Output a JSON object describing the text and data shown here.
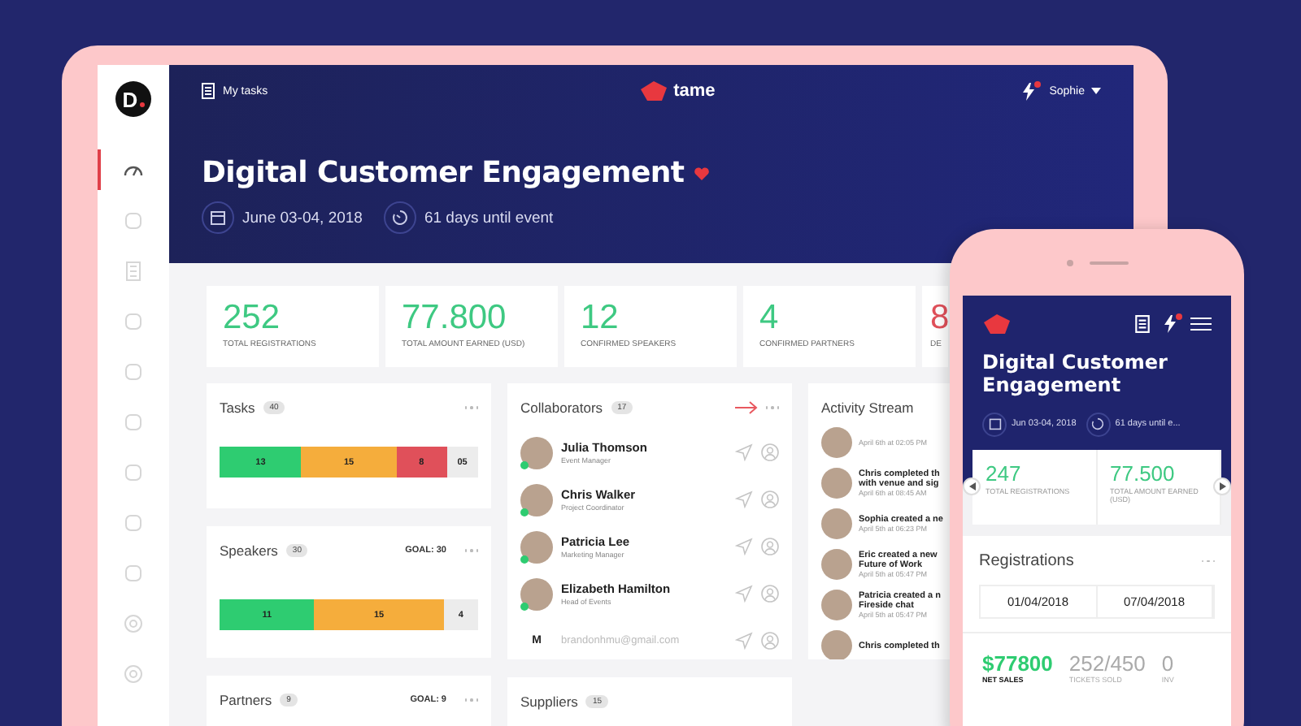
{
  "sidebar": {
    "logo": "D",
    "logo_dot": true,
    "items": [
      {
        "selected": true
      },
      {
        "selected": false
      },
      {
        "selected": false
      },
      {
        "selected": false
      },
      {
        "selected": false
      },
      {
        "selected": false
      },
      {
        "selected": false
      },
      {
        "selected": false
      },
      {
        "selected": false
      },
      {
        "selected": false
      },
      {
        "selected": false
      }
    ]
  },
  "header": {
    "my_tasks": "My tasks",
    "brand": "tame",
    "notification": true,
    "user": "Sophie",
    "title": "Digital Customer Engagement",
    "favorite": true,
    "date": "June 03-04, 2018",
    "countdown": "61 days until event"
  },
  "stats": [
    {
      "value": "252",
      "label": "TOTAL REGISTRATIONS",
      "color": "#3ec982"
    },
    {
      "value": "77.800",
      "label": "TOTAL AMOUNT EARNED (USD)",
      "color": "#3ec982"
    },
    {
      "value": "12",
      "label": "CONFIRMED SPEAKERS",
      "color": "#3ec982"
    },
    {
      "value": "4",
      "label": "CONFIRMED PARTNERS",
      "color": "#3ec982"
    },
    {
      "value": "8",
      "label": "DE",
      "color": "#e0505a"
    }
  ],
  "tasks": {
    "title": "Tasks",
    "count": "40",
    "segments": [
      {
        "label": "13",
        "color": "#2ecc71"
      },
      {
        "label": "15",
        "color": "#f5ad3c"
      },
      {
        "label": "8",
        "color": "#e0505a"
      },
      {
        "label": "05",
        "color": "#ececec"
      }
    ]
  },
  "speakers": {
    "title": "Speakers",
    "count": "30",
    "goal": "GOAL: 30",
    "segments": [
      {
        "label": "11",
        "color": "#2ecc71"
      },
      {
        "label": "15",
        "color": "#f5ad3c"
      },
      {
        "label": "4",
        "color": "#ececec"
      }
    ]
  },
  "partners": {
    "title": "Partners",
    "count": "9",
    "goal": "GOAL: 9"
  },
  "collaborators": {
    "title": "Collaborators",
    "count": "17",
    "people": [
      {
        "name": "Julia Thomson",
        "role": "Event Manager",
        "online": true
      },
      {
        "name": "Chris Walker",
        "role": "Project Coordinator",
        "online": true
      },
      {
        "name": "Patricia Lee",
        "role": "Marketing Manager",
        "online": true
      },
      {
        "name": "Elizabeth Hamilton",
        "role": "Head of Events",
        "online": true
      }
    ],
    "invite": {
      "initial": "M",
      "email": "brandonhmu@gmail.com"
    }
  },
  "suppliers": {
    "title": "Suppliers",
    "count": "15"
  },
  "activity": {
    "title": "Activity Stream",
    "items": [
      {
        "time": "April 6th at 02:05 PM"
      },
      {
        "lines": [
          "Chris completed th",
          "with venue and sig"
        ],
        "time": "April 6th at 08:45 AM"
      },
      {
        "lines": [
          "Sophia created a ne"
        ],
        "time": "April 5th at 06:23 PM"
      },
      {
        "lines": [
          "Eric created a new",
          "Future of Work"
        ],
        "time": "April 5th at 05:47 PM"
      },
      {
        "lines": [
          "Patricia created a n",
          "Fireside chat"
        ],
        "time": "April 5th at 05:47 PM"
      },
      {
        "lines": [
          "Chris completed th"
        ]
      }
    ]
  },
  "phone": {
    "notification": true,
    "title": "Digital Customer Engagement",
    "date": "Jun 03-04, 2018",
    "countdown": "61 days until e...",
    "stats": [
      {
        "value": "247",
        "label": "TOTAL REGISTRATIONS"
      },
      {
        "value": "77.500",
        "label": "TOTAL AMOUNT EARNED (USD)"
      }
    ],
    "section": "Registrations",
    "dates": [
      "01/04/2018",
      "07/04/2018"
    ],
    "figures": [
      {
        "value": "$77800",
        "label": "NET SALES",
        "kind": "money"
      },
      {
        "value": "252/450",
        "label": "TICKETS SOLD",
        "kind": "plain"
      },
      {
        "value": "0",
        "label": "INV",
        "kind": "plain"
      }
    ]
  }
}
